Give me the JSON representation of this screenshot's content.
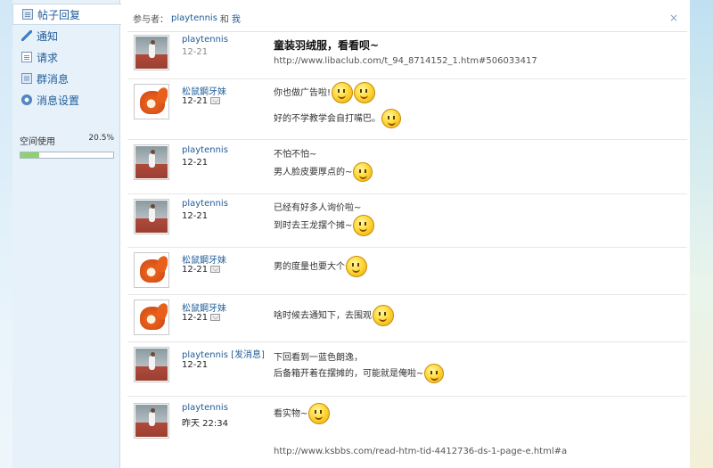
{
  "sidebar": {
    "items": [
      {
        "label": "帖子回复",
        "icon": "board-icon"
      },
      {
        "label": "通知",
        "icon": "pencil-icon"
      },
      {
        "label": "请求",
        "icon": "document-icon"
      },
      {
        "label": "群消息",
        "icon": "group-icon"
      },
      {
        "label": "消息设置",
        "icon": "gear-icon"
      }
    ],
    "space_label": "空间使用",
    "space_percent": "20.5%",
    "space_fraction": 0.205
  },
  "participants": {
    "prefix": "参与者：",
    "user": "playtennis",
    "conj": "和",
    "me": "我",
    "close": "×"
  },
  "messages": [
    {
      "user": "playtennis",
      "time": "12-21",
      "subject": "童装羽绒服，看看呗~",
      "link": "http://www.libaclub.com/t_94_8714152_1.htm#506033417"
    },
    {
      "user": "松鼠鋼牙妹",
      "time": "12-21",
      "line1": "你也做广告啦!",
      "line2": "好的不学教学会自打嘴巴。"
    },
    {
      "user": "playtennis",
      "time": "12-21",
      "line1": "不怕不怕~",
      "line2": "男人脸皮要厚点的~"
    },
    {
      "user": "playtennis",
      "time": "12-21",
      "line1": "已经有好多人询价啦~",
      "line2": "到时去王龙摆个摊~"
    },
    {
      "user": "松鼠鋼牙妹",
      "time": "12-21",
      "line1": "男的度量也要大个"
    },
    {
      "user": "松鼠鋼牙妹",
      "time": "12-21",
      "line1": "啥时候去通知下，去围观"
    },
    {
      "user": "playtennis",
      "send": "[发消息]",
      "time": "12-21",
      "line1": "下回看到一蓝色朗逸，",
      "line2": "后备箱开着在摆摊的，可能就是俺啦~"
    },
    {
      "user": "playtennis",
      "time": "昨天 22:34",
      "line1": "看实物~",
      "link": "http://www.ksbbs.com/read-htm-tid-4412736-ds-1-page-e.html#a"
    }
  ]
}
